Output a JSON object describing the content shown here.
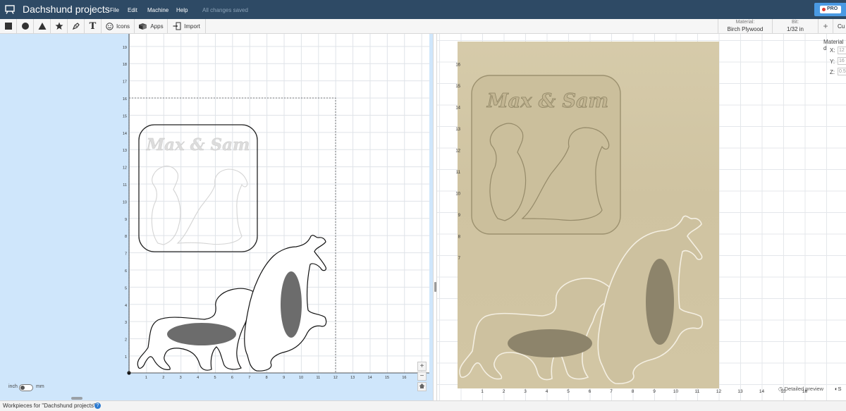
{
  "app": {
    "project_title": "Dachshund projects",
    "save_status": "All changes saved",
    "pro_label": "PRO"
  },
  "menu": [
    "File",
    "Edit",
    "Machine",
    "Help"
  ],
  "toolbar": {
    "icons_label": "Icons",
    "apps_label": "Apps",
    "import_label": "Import",
    "material_label": "Material:",
    "material_value": "Birch Plywood",
    "bit_label": "Bit:",
    "bit_value": "1/32 in",
    "plus_label": "+",
    "cut_label": "Cu"
  },
  "design": {
    "title_text": "Max & Sam"
  },
  "axes": {
    "left_x": [
      "1",
      "2",
      "3",
      "4",
      "5",
      "6",
      "7",
      "8",
      "9",
      "10",
      "11",
      "12",
      "13",
      "14",
      "15",
      "16"
    ],
    "left_y": [
      "1",
      "2",
      "3",
      "4",
      "5",
      "6",
      "7",
      "8",
      "9",
      "10",
      "11",
      "12",
      "13",
      "14",
      "15",
      "16",
      "17",
      "18",
      "19"
    ],
    "right_x": [
      "1",
      "2",
      "3",
      "4",
      "5",
      "6",
      "7",
      "8",
      "9",
      "10",
      "11",
      "12",
      "13",
      "14",
      "15",
      "16"
    ],
    "right_y": [
      "7",
      "8",
      "9",
      "10",
      "11",
      "12",
      "13",
      "14",
      "15",
      "16"
    ]
  },
  "material_panel": {
    "title": "Material d",
    "x_label": "X:",
    "x_value": "12",
    "y_label": "Y:",
    "y_value": "16",
    "z_label": "Z:",
    "z_value": "0.5"
  },
  "units": {
    "left": "inch",
    "right": "mm"
  },
  "zoom": {
    "in": "+",
    "out": "−"
  },
  "preview": {
    "detailed_label": "Detailed preview",
    "side_label": "S"
  },
  "bottom": {
    "workpieces_label": "Workpieces for \"Dachshund projects\" ˄",
    "help_label": "?"
  },
  "colors": {
    "topbar": "#2e4a65",
    "workspace": "#cfe6fb",
    "plywood": "#d3c7a5",
    "pocket": "#6c6c6c",
    "accent": "#4a9ae3"
  }
}
